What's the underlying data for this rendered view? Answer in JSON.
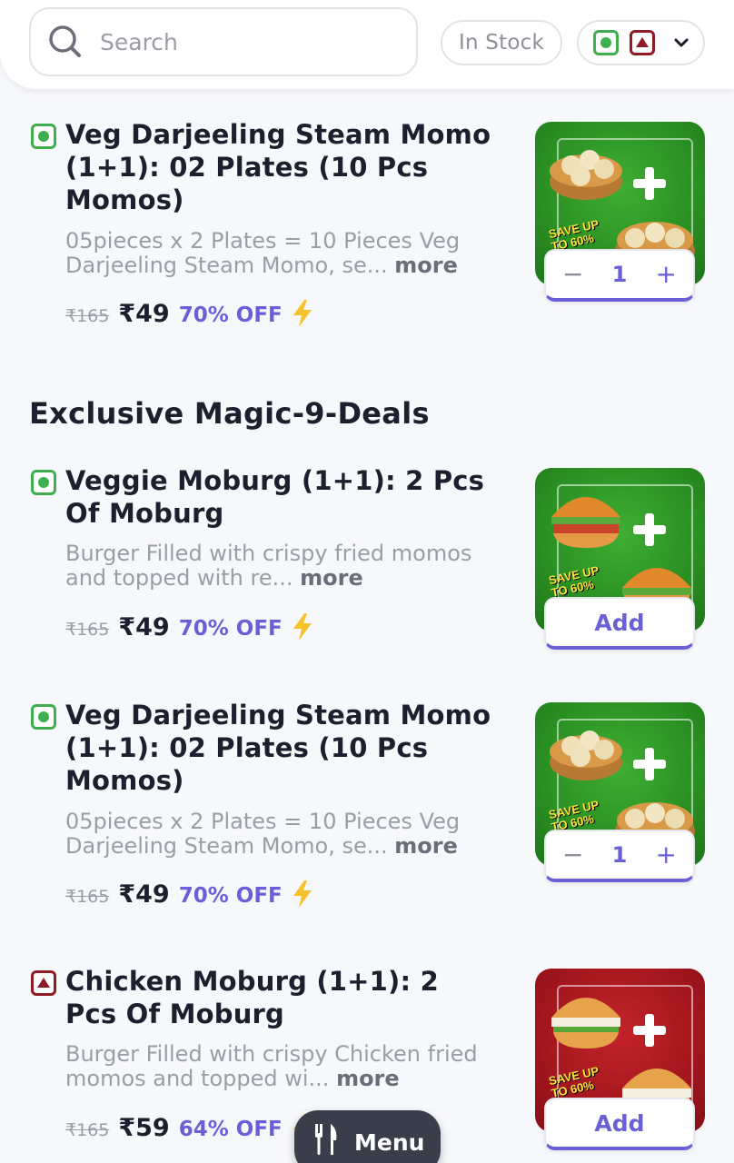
{
  "search": {
    "placeholder": "Search",
    "value": ""
  },
  "filters": {
    "stock_label": "In Stock"
  },
  "section": {
    "title": "Exclusive Magic-9-Deals"
  },
  "items": [
    {
      "type": "veg",
      "title": "Veg Darjeeling Steam Momo (1+1): 02 Plates (10 Pcs Momos)",
      "desc": "05pieces x 2 Plates = 10 Pieces Veg Darjeeling Steam Momo, se...",
      "more": "more",
      "old_price": "₹165",
      "price": "₹49",
      "discount": "70% OFF",
      "thumb_promo": "SAVE UP TO 60%",
      "control": "qty",
      "qty": "1"
    },
    {
      "type": "veg",
      "title": "Veggie Moburg (1+1): 2 Pcs Of Moburg",
      "desc": "Burger Filled with crispy fried momos and topped with re...",
      "more": "more",
      "old_price": "₹165",
      "price": "₹49",
      "discount": "70% OFF",
      "thumb_promo": "SAVE UP TO 60%",
      "control": "add",
      "add_label": "Add"
    },
    {
      "type": "veg",
      "title": "Veg Darjeeling Steam Momo (1+1): 02 Plates (10 Pcs Momos)",
      "desc": "05pieces x 2 Plates = 10 Pieces Veg Darjeeling Steam Momo, se...",
      "more": "more",
      "old_price": "₹165",
      "price": "₹49",
      "discount": "70% OFF",
      "thumb_promo": "SAVE UP TO 60%",
      "control": "qty",
      "qty": "1"
    },
    {
      "type": "nonveg",
      "title": "Chicken Moburg (1+1): 2 Pcs Of Moburg",
      "desc": "Burger Filled with crispy Chicken fried momos and topped wi...",
      "more": "more",
      "old_price": "₹165",
      "price": "₹59",
      "discount": "64% OFF",
      "thumb_promo": "SAVE UP TO 60%",
      "control": "add",
      "add_label": "Add"
    }
  ],
  "menu_fab": {
    "label": "Menu"
  },
  "colors": {
    "accent": "#6a5fd6",
    "veg": "#3eae4f",
    "nonveg": "#8e1b26",
    "promo_green": "#2a8f22",
    "promo_red": "#a3161d"
  },
  "icons": [
    "search-icon",
    "veg-icon",
    "nonveg-icon",
    "chevron-down-icon",
    "bolt-icon",
    "fork-knife-icon"
  ]
}
